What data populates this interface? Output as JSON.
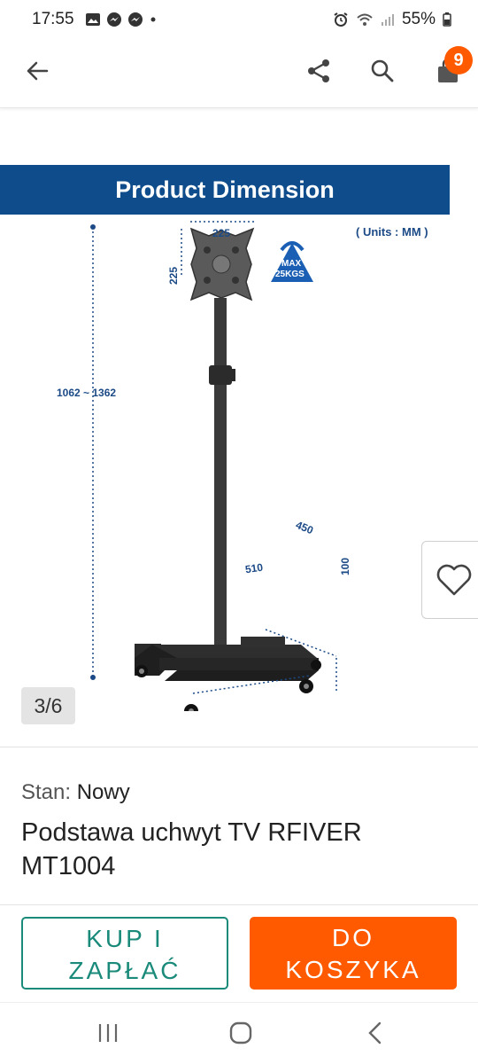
{
  "status_bar": {
    "time": "17:55",
    "battery": "55%"
  },
  "header": {
    "back_icon": "arrow-left-icon",
    "share_icon": "share-icon",
    "search_icon": "search-icon",
    "cart_icon": "shopping-bag-icon",
    "cart_count": "9",
    "accent_color": "#ff5a00"
  },
  "gallery": {
    "banner_title": "Product Dimension",
    "units_note": "( Units : MM )",
    "badge_top": "MAX",
    "badge_bottom": "25KGS",
    "dims": {
      "mount_width": "225",
      "mount_height": "225",
      "height_range": "1062 ~ 1362",
      "depth": "450",
      "base_width": "510",
      "base_height": "100"
    },
    "counter": "3/6",
    "favorite_icon": "heart-icon"
  },
  "product": {
    "condition_label": "Stan:",
    "condition_value": "Nowy",
    "title": "Podstawa uchwyt TV RFIVER MT1004"
  },
  "actions": {
    "buy_now_line1": "KUP I",
    "buy_now_line2": "ZAPŁAĆ",
    "add_to_cart_line1": "DO",
    "add_to_cart_line2": "KOSZYKA"
  },
  "system_nav": {
    "recents_icon": "recents-icon",
    "home_icon": "home-icon",
    "back_icon": "back-chevron-icon"
  }
}
